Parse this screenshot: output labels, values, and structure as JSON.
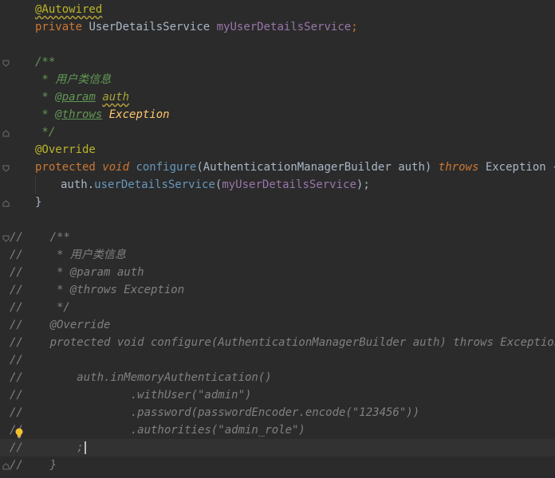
{
  "lines": {
    "l1": {
      "autowired": "@Autowired"
    },
    "l2": {
      "private": "private",
      "type": "UserDetailsService",
      "field": "myUserDetailsService",
      "semi": ";"
    },
    "l4": {
      "text": "/**"
    },
    "l5": {
      "text": " * 用户类信息"
    },
    "l6": {
      "pre": " * ",
      "tag": "@param",
      "sp": " ",
      "param": "auth"
    },
    "l7": {
      "pre": " * ",
      "tag": "@throws",
      "sp": " ",
      "exc": "Exception"
    },
    "l8": {
      "text": " */"
    },
    "l9": {
      "override": "@Override"
    },
    "l10": {
      "protected": "protected",
      "void": "void",
      "method": "configure",
      "open": "(",
      "ptype": "AuthenticationManagerBuilder",
      "pname": "auth",
      "close": ")",
      "throws": "throws",
      "exc": "Exception",
      "brace": "{"
    },
    "l11": {
      "obj": "auth",
      "dot": ".",
      "call": "userDetailsService",
      "open": "(",
      "arg": "myUserDetailsService",
      "close": ");"
    },
    "l12": {
      "text": "}"
    },
    "c1": "//    /**",
    "c2": "//     * 用户类信息",
    "c3": "//     * @param auth",
    "c4": "//     * @throws Exception",
    "c5": "//     */",
    "c6": "//    @Override",
    "c7": "//    protected void configure(AuthenticationManagerBuilder auth) throws Exception {",
    "c8": "//",
    "c9": "//        auth.inMemoryAuthentication()",
    "c10": "//                .withUser(\"admin\")",
    "c11": "//                .password(passwordEncoder.encode(\"123456\"))",
    "c12": "//                .authorities(\"admin_role\")",
    "c13": "//        ;",
    "c14": "//    }"
  },
  "icons": {
    "fold": "fold-marker-icon",
    "bulb": "lightbulb-icon"
  },
  "colors": {
    "background": "#2b2b2b",
    "keyword": "#cc7832",
    "annotation": "#bbb529",
    "method": "#ffc66d",
    "field": "#9876aa",
    "comment": "#808080",
    "doc": "#629755"
  }
}
